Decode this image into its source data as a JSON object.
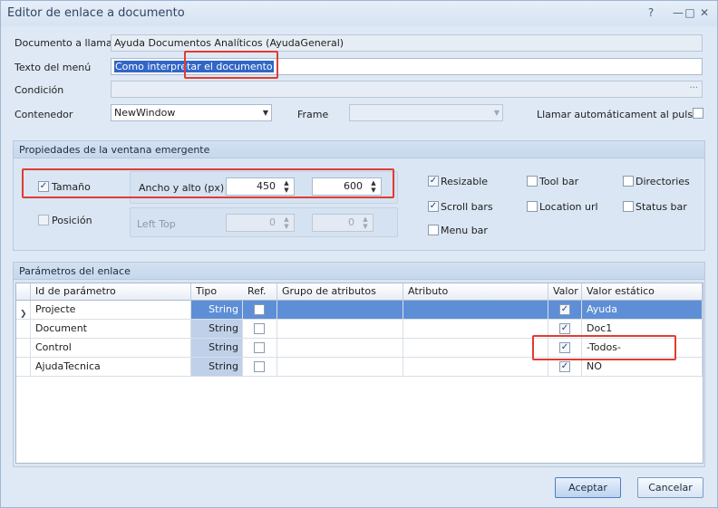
{
  "window": {
    "title": "Editor de enlace a documento",
    "controls": {
      "help": "?",
      "minimize": "—",
      "maximize": "□",
      "close": "✕"
    }
  },
  "form": {
    "documento_label": "Documento a llamar",
    "documento_value": "Ayuda Documentos Analíticos (AyudaGeneral)",
    "texto_label": "Texto del menú",
    "texto_value": "Como interpretar el documento",
    "condicion_label": "Condición",
    "condicion_value": "",
    "condicion_ellipsis": "···",
    "contenedor_label": "Contenedor",
    "contenedor_value": "NewWindow",
    "frame_label": "Frame",
    "frame_value": "",
    "llamar_label": "Llamar automáticament al pulsar",
    "llamar_checked": false,
    "dropdown_glyph": "▼"
  },
  "popup": {
    "title": "Propiedades de la ventana emergente",
    "tamano_label": "Tamaño",
    "tamano_checked": true,
    "ancho_alto_label": "Ancho y alto (px)",
    "ancho": "450",
    "alto": "600",
    "posicion_label": "Posición",
    "posicion_checked": false,
    "left_top_label": "Left  Top",
    "left": "0",
    "top": "0",
    "options": [
      {
        "label": "Resizable",
        "checked": true
      },
      {
        "label": "Tool bar",
        "checked": false
      },
      {
        "label": "Directories",
        "checked": false
      },
      {
        "label": "Scroll bars",
        "checked": true
      },
      {
        "label": "Location url",
        "checked": false
      },
      {
        "label": "Status bar",
        "checked": false
      },
      {
        "label": "Menu bar",
        "checked": false
      }
    ]
  },
  "params": {
    "title": "Parámetros del enlace",
    "columns": [
      "Id de parámetro",
      "Tipo",
      "Ref.",
      "Grupo de atributos",
      "Atributo",
      "Valor",
      "Valor estático"
    ],
    "rows": [
      {
        "id": "Projecte",
        "tipo": "String",
        "ref": false,
        "grupo": "",
        "atributo": "",
        "valor": true,
        "estatico": "Ayuda",
        "selected": true
      },
      {
        "id": "Document",
        "tipo": "String",
        "ref": false,
        "grupo": "",
        "atributo": "",
        "valor": true,
        "estatico": "Doc1",
        "selected": false
      },
      {
        "id": "Control",
        "tipo": "String",
        "ref": false,
        "grupo": "",
        "atributo": "",
        "valor": true,
        "estatico": "-Todos-",
        "selected": false
      },
      {
        "id": "AjudaTecnica",
        "tipo": "String",
        "ref": false,
        "grupo": "",
        "atributo": "",
        "valor": true,
        "estatico": "NO",
        "selected": false
      }
    ],
    "row_indicator": "❯"
  },
  "buttons": {
    "aceptar": "Aceptar",
    "cancelar": "Cancelar"
  },
  "checkmark": "✓",
  "colors": {
    "highlight": "#e03c31",
    "selection": "#5e8fd6",
    "accent": "#3166c7"
  }
}
